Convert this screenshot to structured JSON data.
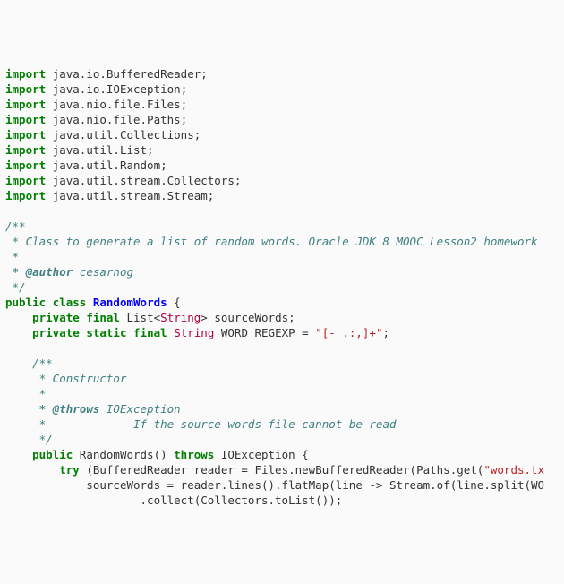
{
  "filename": "RandomWords.java",
  "imports": [
    "java.io.BufferedReader",
    "java.io.IOException",
    "java.nio.file.Files",
    "java.nio.file.Paths",
    "java.util.Collections",
    "java.util.List",
    "java.util.Random",
    "java.util.stream.Collectors",
    "java.util.stream.Stream"
  ],
  "class_doc": {
    "open": "/**",
    "line1": " * Class to generate a list of random words. Oracle JDK 8 MOOC Lesson2 homework",
    "blank": " *",
    "author_tag": " * @author",
    "author_name": " cesarnog",
    "close": " */"
  },
  "decl": {
    "public": "public",
    "class_kw": "class",
    "class_name": "RandomWords",
    "open_brace": " {"
  },
  "fields": {
    "private": "private",
    "final": "final",
    "static": "static",
    "list": "List",
    "lt": "<",
    "gt": ">",
    "string": "String",
    "source_words": " sourceWords;",
    "word_regexp_decl": " WORD_REGEXP = ",
    "word_regexp_val": "\"[- .:,]+\"",
    "semi": ";"
  },
  "ctor_doc": {
    "open": "/**",
    "l1": " * Constructor",
    "l2": " *",
    "throws_tag": " * @throws",
    "throws_type": " IOException",
    "l4": " *             If the source words file cannot be read",
    "close": " */"
  },
  "ctor": {
    "public": "public",
    "name": " RandomWords() ",
    "throws": "throws",
    "throws_type": " IOException {",
    "try": "try",
    "try_rest": " (BufferedReader reader = Files.newBufferedReader(Paths.get(",
    "str": "\"words.tx",
    "line2a": "sourceWords = reader.lines().flatMap(line ",
    "arrow": "->",
    "line2b": " Stream.of(line.split(WO",
    "line3": ".collect(Collectors.toList());"
  },
  "kw": {
    "import": "import"
  },
  "indent1": "    ",
  "indent2": "        ",
  "indent3": "            ",
  "indent4": "                    "
}
